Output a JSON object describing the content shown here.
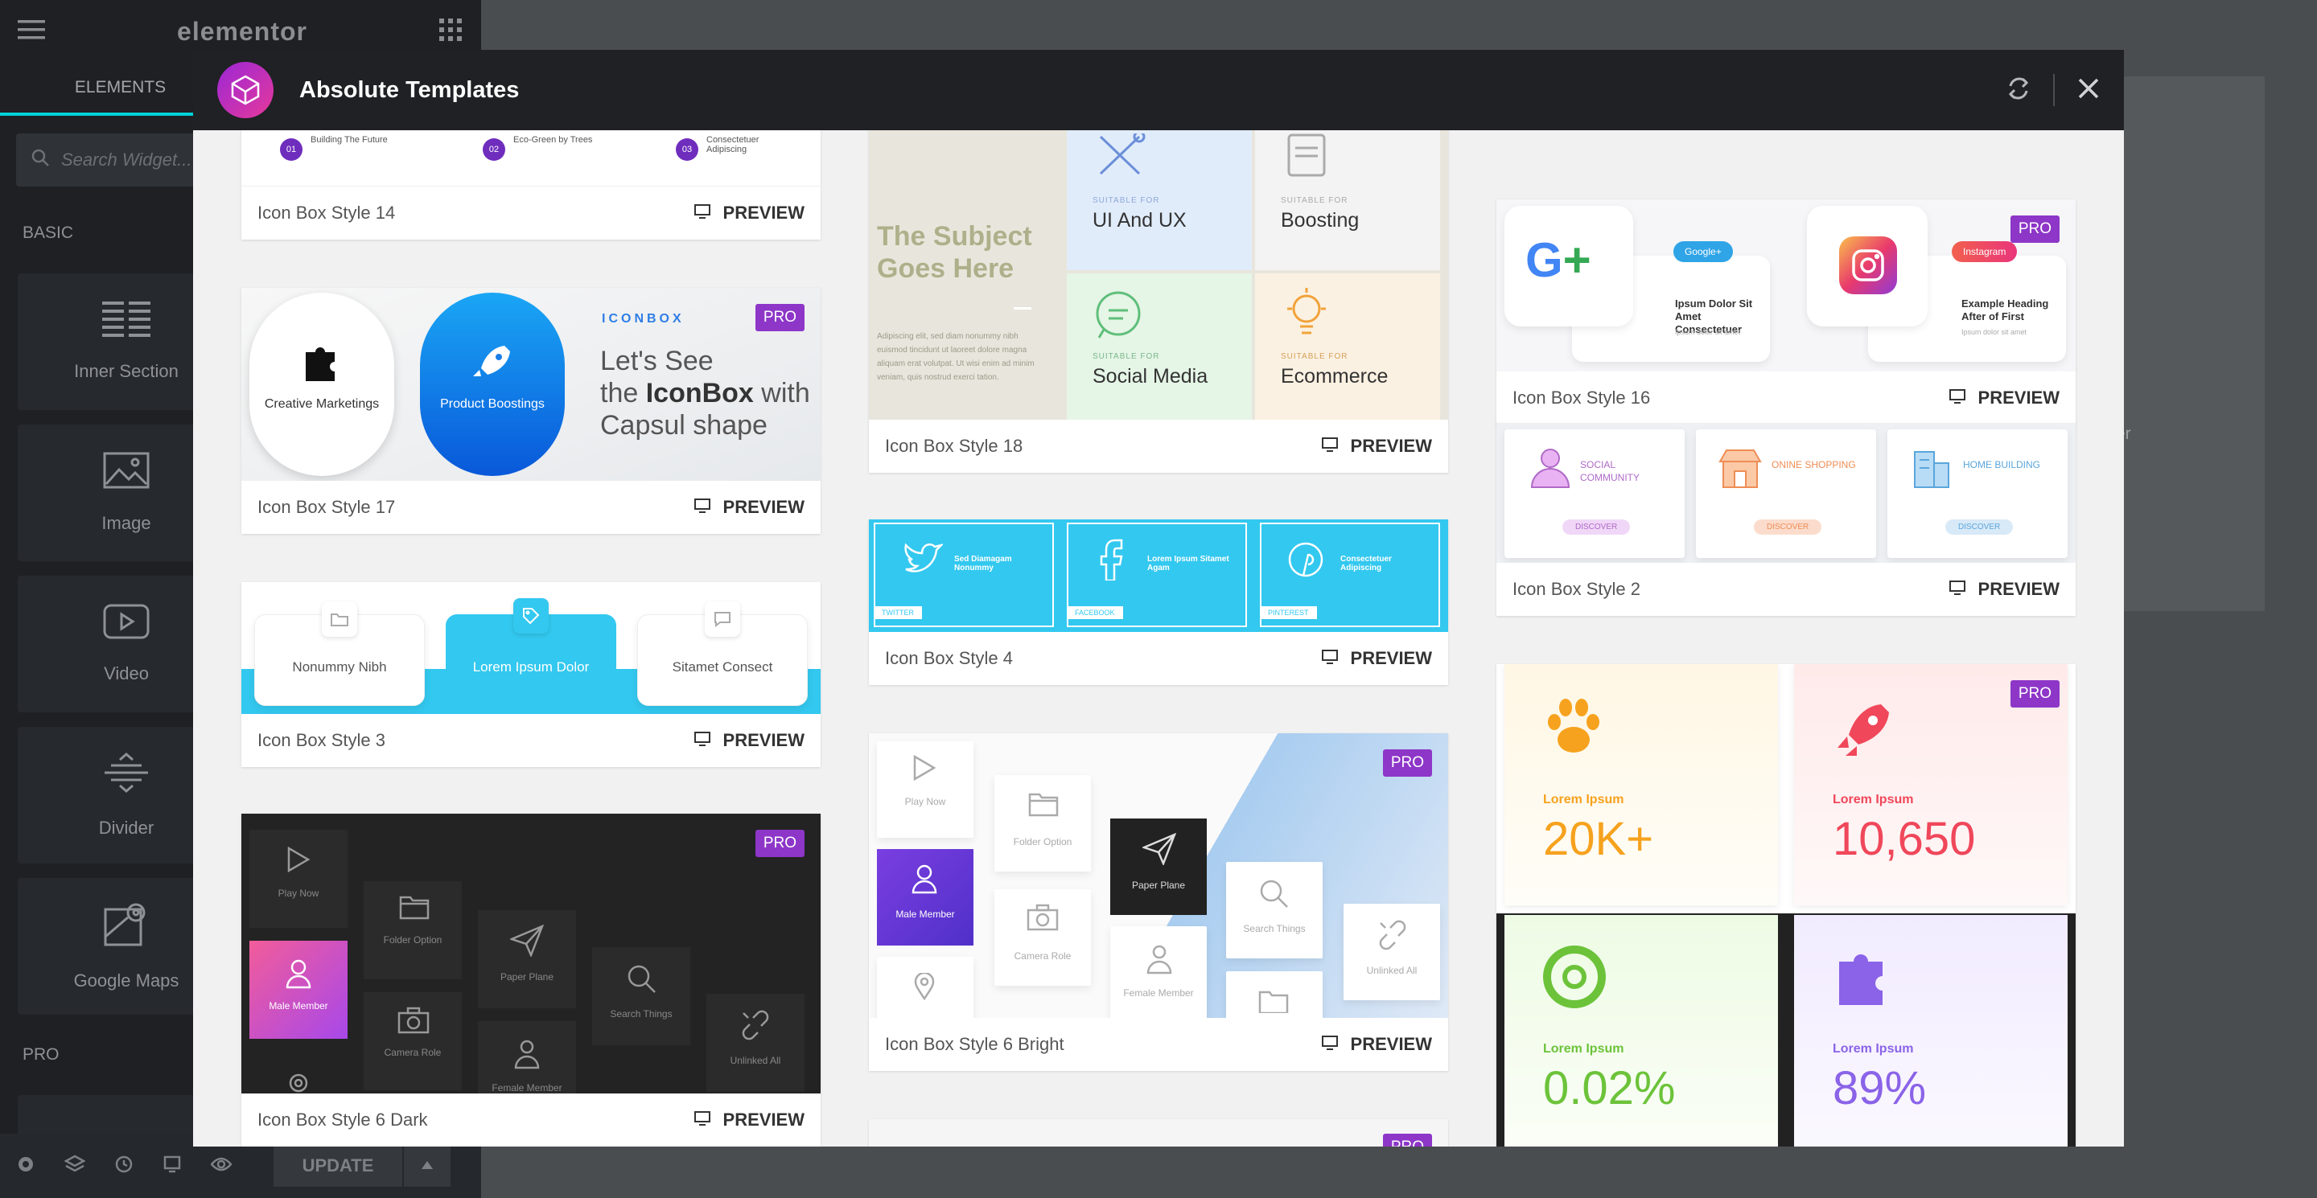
{
  "sidebar": {
    "logo": "elementor",
    "tabs": [
      "ELEMENTS"
    ],
    "search_placeholder": "Search Widget...",
    "basic_label": "BASIC",
    "pro_label": "PRO",
    "widgets": [
      "Inner Section",
      "Image",
      "Video",
      "Divider",
      "Google Maps"
    ],
    "update_label": "UPDATE"
  },
  "canvas": {
    "text": "er"
  },
  "modal": {
    "title": "Absolute Templates"
  },
  "cards": {
    "preview_label": "PREVIEW",
    "pro_label": "PRO",
    "c14": {
      "name": "Icon Box Style 14",
      "steps": [
        "Building The Future",
        "Eco-Green by Trees",
        "Consectetuer Adipiscing"
      ],
      "nums": [
        "01",
        "02",
        "03"
      ]
    },
    "c17": {
      "name": "Icon Box Style 17",
      "tag": "ICONBOX",
      "line1": "Let's See",
      "line2a": "the ",
      "line2b": "IconBox",
      "line2c": " with",
      "line3": "Capsul shape",
      "item1": "Creative Marketings",
      "item2": "Product Boostings"
    },
    "c3": {
      "name": "Icon Box Style 3",
      "items": [
        "Nonummy Nibh",
        "Lorem Ipsum Dolor",
        "Sitamet Consect"
      ]
    },
    "c6d": {
      "name": "Icon Box Style 6 Dark",
      "items": [
        "Play Now",
        "Folder Option",
        "Paper Plane",
        "Search Things",
        "Male Member",
        "Camera Role",
        "Female Member",
        "Unlinked All"
      ]
    },
    "c18": {
      "name": "Icon Box Style 18",
      "head1": "The Subject",
      "head2": "Goes Here",
      "body": "Adipiscing elit, sed diam nonummy nibh euismod tincidunt ut laoreet dolore magna aliquam erat volutpat. Ut wisi enim ad minim veniam, quis nostrud exerci tation.",
      "suitable": "SUITABLE FOR",
      "items": [
        "UI And UX",
        "Boosting",
        "Social Media",
        "Ecommerce"
      ]
    },
    "c4": {
      "name": "Icon Box Style 4",
      "items": [
        "Sed Diamagam Nonummy",
        "Lorem Ipsum Sitamet Agam",
        "Consectetuer Adipiscing"
      ],
      "tags": [
        "TWITTER",
        "FACEBOOK",
        "PINTEREST"
      ]
    },
    "c6b": {
      "name": "Icon Box Style 6 Bright",
      "items": [
        "Play Now",
        "Folder Option",
        "Paper Plane",
        "Search Things",
        "Male Member",
        "Camera Role",
        "Female Member",
        "Unlinked All"
      ]
    },
    "c16": {
      "name": "Icon Box Style 16",
      "badge1": "Google+",
      "badge2": "Instagram",
      "text1": "Ipsum Dolor Sit Amet Consectetuer",
      "text2": "Example Heading After of First",
      "sub": "Ipsum dolor sit amet"
    },
    "c2": {
      "name": "Icon Box Style 2",
      "items": [
        "SOCIAL COMMUNITY",
        "ONINE SHOPPING",
        "HOME BUILDING"
      ],
      "btn": "DISCOVER"
    },
    "cbig": {
      "labels": [
        "Lorem Ipsum",
        "Lorem Ipsum",
        "Lorem Ipsum",
        "Lorem Ipsum"
      ],
      "values": [
        "20K+",
        "10,650",
        "0.02%",
        "89%"
      ]
    }
  },
  "colors": {
    "accent": "#00d2d8",
    "pro": "#8d36c8",
    "cyan": "#33c8ef"
  }
}
